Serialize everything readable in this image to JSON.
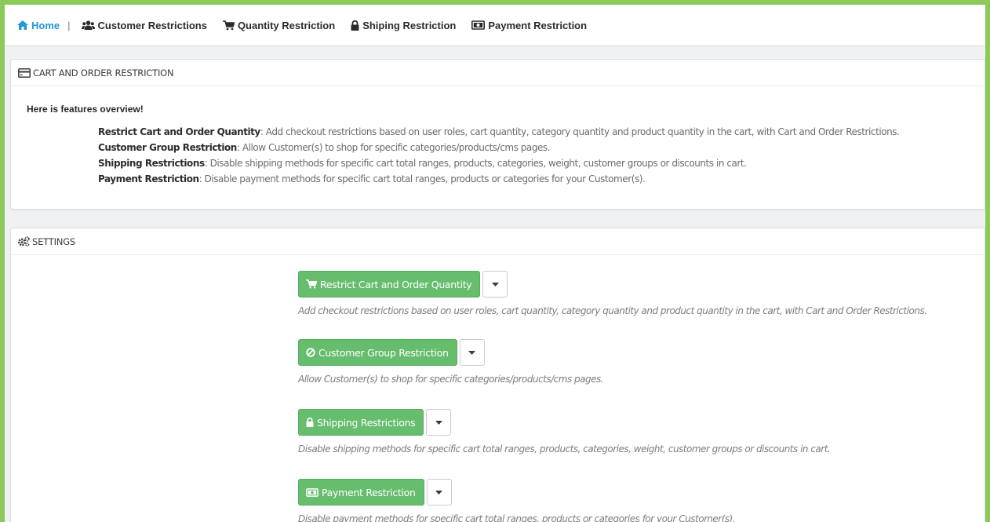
{
  "nav": {
    "home": "Home",
    "separator": "|",
    "items": [
      {
        "label": "Customer Restrictions",
        "icon": "users-icon"
      },
      {
        "label": "Quantity Restriction",
        "icon": "cart-icon"
      },
      {
        "label": "Shiping Restriction",
        "icon": "lock-icon"
      },
      {
        "label": "Payment Restriction",
        "icon": "money-icon"
      }
    ]
  },
  "overview_panel": {
    "title": "CART AND ORDER RESTRICTION",
    "intro": "Here is features overview!",
    "features": [
      {
        "name": "Restrict Cart and Order Quantity",
        "desc": ": Add checkout restrictions based on user roles, cart quantity, category quantity and product quantity in the cart, with Cart and Order Restrictions."
      },
      {
        "name": "Customer Group Restriction",
        "desc": ": Allow Customer(s) to shop for specific categories/products/cms pages."
      },
      {
        "name": "Shipping Restrictions",
        "desc": ": Disable shipping methods for specific cart total ranges, products, categories, weight, customer groups or discounts in cart."
      },
      {
        "name": "Payment Restriction",
        "desc": ": Disable payment methods for specific cart total ranges, products or categories for your Customer(s)."
      }
    ]
  },
  "settings_panel": {
    "title": "SETTINGS",
    "buttons": [
      {
        "label": "Restrict Cart and Order Quantity",
        "icon": "cart-icon",
        "help": "Add checkout restrictions based on user roles, cart quantity, category quantity and product quantity in the cart, with Cart and Order Restrictions."
      },
      {
        "label": "Customer Group Restriction",
        "icon": "ban-icon",
        "help": "Allow Customer(s) to shop for specific categories/products/cms pages."
      },
      {
        "label": "Shipping Restrictions",
        "icon": "lock-icon",
        "help": "Disable shipping methods for specific cart total ranges, products, categories, weight, customer groups or discounts in cart."
      },
      {
        "label": "Payment Restriction",
        "icon": "money-icon",
        "help": "Disable payment methods for specific cart total ranges, products or categories for your Customer(s)."
      }
    ]
  },
  "colors": {
    "frame_border": "#8dc85b",
    "button_green": "#66bd6d",
    "link_blue": "#1f9ad6"
  }
}
